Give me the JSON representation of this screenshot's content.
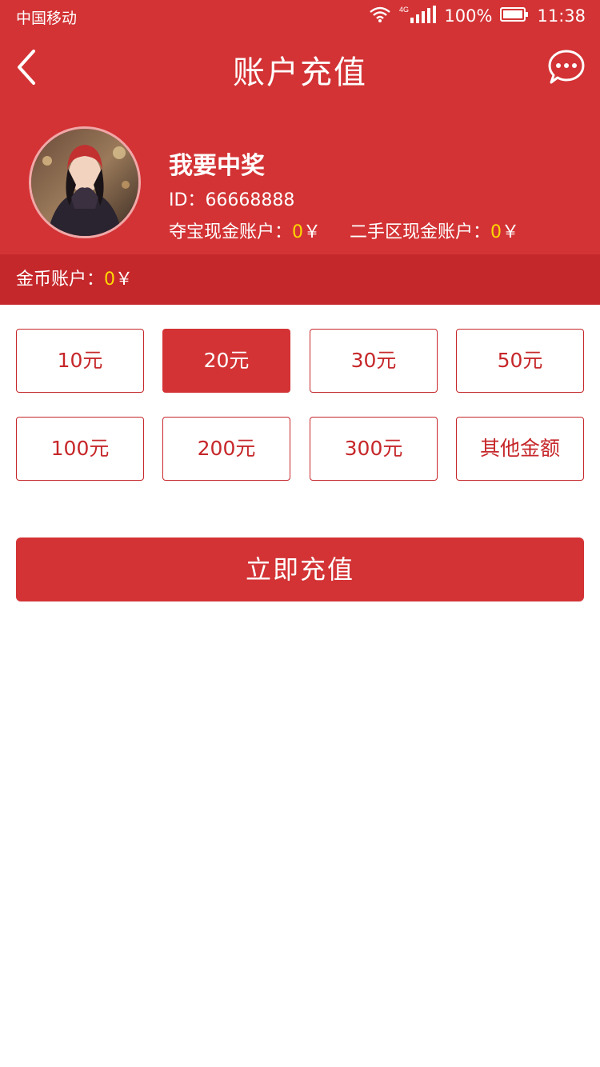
{
  "status_bar": {
    "carrier": "中国移动",
    "network": "4G",
    "battery": "100%",
    "time": "11:38"
  },
  "nav": {
    "title": "账户充值",
    "back_icon": "chevron-left-icon",
    "message_icon": "chat-bubble-icon"
  },
  "profile": {
    "name": "我要中奖",
    "id_label": "ID：",
    "id_value": "66668888",
    "treasure_label": "夺宝现金账户：",
    "treasure_value": "0",
    "secondhand_label": "二手区现金账户：",
    "secondhand_value": "0",
    "currency": "￥"
  },
  "coin_account": {
    "label": "金币账户：",
    "value": "0",
    "currency": "￥"
  },
  "amounts": [
    {
      "label": "10元",
      "selected": false
    },
    {
      "label": "20元",
      "selected": true
    },
    {
      "label": "30元",
      "selected": false
    },
    {
      "label": "50元",
      "selected": false
    },
    {
      "label": "100元",
      "selected": false
    },
    {
      "label": "200元",
      "selected": false
    },
    {
      "label": "300元",
      "selected": false
    },
    {
      "label": "其他金额",
      "selected": false
    }
  ],
  "recharge_button": "立即充值",
  "colors": {
    "primary": "#d33335",
    "dark": "#c5282b",
    "highlight": "#ffd800"
  }
}
